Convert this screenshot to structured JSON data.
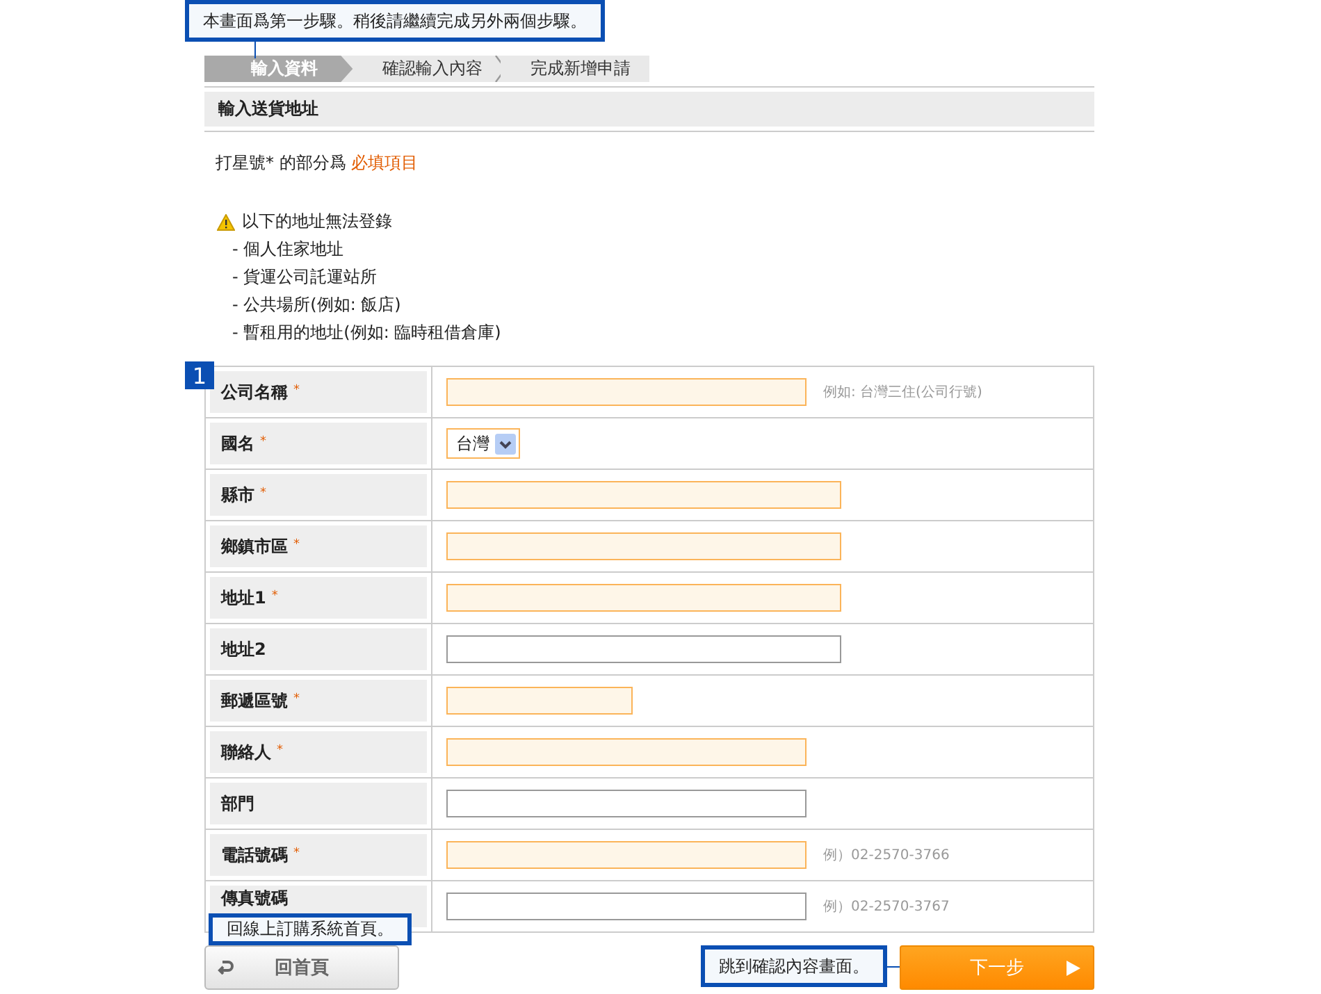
{
  "top_callout": "本畫面爲第一步驟。稍後請繼續完成另外兩個步驟。",
  "steps": [
    {
      "label": "輸入資料",
      "selected": true
    },
    {
      "label": "確認輸入內容",
      "selected": false
    },
    {
      "label": "完成新增申請",
      "selected": false
    }
  ],
  "section_title": "輸入送貨地址",
  "required_note": {
    "text": "打星號* 的部分爲 ",
    "highlight": "必填項目"
  },
  "warning": {
    "title": "以下的地址無法登錄",
    "items": [
      "- 個人住家地址",
      "- 貨運公司託運站所",
      "- 公共場所(例如: 飯店)",
      "- 暫租用的地址(例如: 臨時租借倉庫)"
    ]
  },
  "field_badge": "1",
  "required_mark": "*",
  "fields": [
    {
      "label": "公司名稱",
      "required": true,
      "kind": "text",
      "hint": "例如: 台灣三住(公司行號)"
    },
    {
      "label": "國名",
      "required": true,
      "kind": "select",
      "value": "台灣"
    },
    {
      "label": "縣市",
      "required": true,
      "kind": "text"
    },
    {
      "label": "鄉鎮市區",
      "required": true,
      "kind": "text"
    },
    {
      "label": "地址1",
      "required": true,
      "kind": "text"
    },
    {
      "label": "地址2",
      "required": false,
      "kind": "text"
    },
    {
      "label": "郵遞區號",
      "required": true,
      "kind": "text"
    },
    {
      "label": "聯絡人",
      "required": true,
      "kind": "text"
    },
    {
      "label": "部門",
      "required": false,
      "kind": "text"
    },
    {
      "label": "電話號碼",
      "required": true,
      "kind": "text",
      "hint": "例）02-2570-3766"
    },
    {
      "label": "傳真號碼",
      "required": false,
      "kind": "text",
      "hint": "例）02-2570-3767"
    }
  ],
  "back_callout": "回線上訂購系統首頁。",
  "back_button": "回首頁",
  "next_callout": "跳到確認內容畫面。",
  "next_button": "下一步"
}
